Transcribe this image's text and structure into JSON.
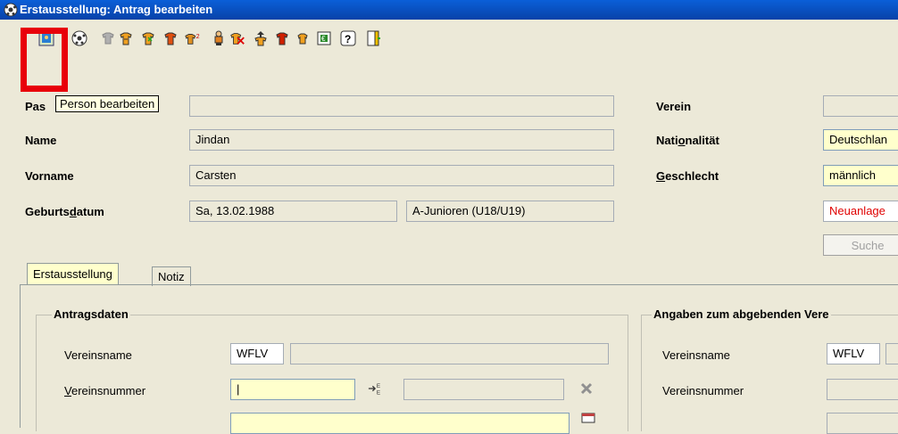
{
  "window": {
    "title": "Erstausstellung: Antrag bearbeiten"
  },
  "toolbar": {
    "tooltip": "Person bearbeiten",
    "icons": [
      "person-edit-icon",
      "ball-icon",
      "shirt-grey-icon",
      "shirts-icon",
      "shirts-2-icon",
      "shirt-red-icon",
      "shirt-2-icon",
      "person-icon",
      "shirt-delete-icon",
      "shirt-transfer-icon",
      "shirt-red-2-icon",
      "shirt-small-icon",
      "euro-document-icon",
      "help-icon",
      "exit-icon"
    ]
  },
  "form": {
    "pass_label": "Pas",
    "name_label": "Name",
    "name_value": "Jindan",
    "vorname_label": "Vorname",
    "vorname_value": "Carsten",
    "geburtsdatum_label_pre": "Geburts",
    "geburtsdatum_label_u": "d",
    "geburtsdatum_label_post": "atum",
    "geburtsdatum_value": "Sa, 13.02.1988",
    "altersklasse_value": "A-Junioren (U18/U19)",
    "verein_label": "Verein",
    "nationalitaet_label_pre": "Nati",
    "nationalitaet_label_u": "o",
    "nationalitaet_label_post": "nalität",
    "nationalitaet_value": "Deutschlan",
    "geschlecht_label_u": "G",
    "geschlecht_label_post": "eschlecht",
    "geschlecht_value": "männlich",
    "status_value": "Neuanlage",
    "suche_button": "Suche"
  },
  "tabs": [
    {
      "label": "Erstausstellung"
    },
    {
      "label": "Notiz"
    }
  ],
  "antragsdaten": {
    "title": "Antragsdaten",
    "vereinsname_label": "Vereinsname",
    "vereinsname_prefix": "WFLV",
    "vereinsnummer_label_u": "V",
    "vereinsnummer_label_post": "ereinsnummer",
    "vereinsnummer_value": "|"
  },
  "abgebend": {
    "title": "Angaben zum abgebenden Vere",
    "vereinsname_label": "Vereinsname",
    "vereinsname_prefix": "WFLV",
    "vereinsnummer_label": "Vereinsnummer"
  },
  "colors": {
    "titlebar": "#0a5fd8",
    "highlight": "#e8000a",
    "status": "#e00000",
    "yellow_field": "#ffffcc"
  }
}
